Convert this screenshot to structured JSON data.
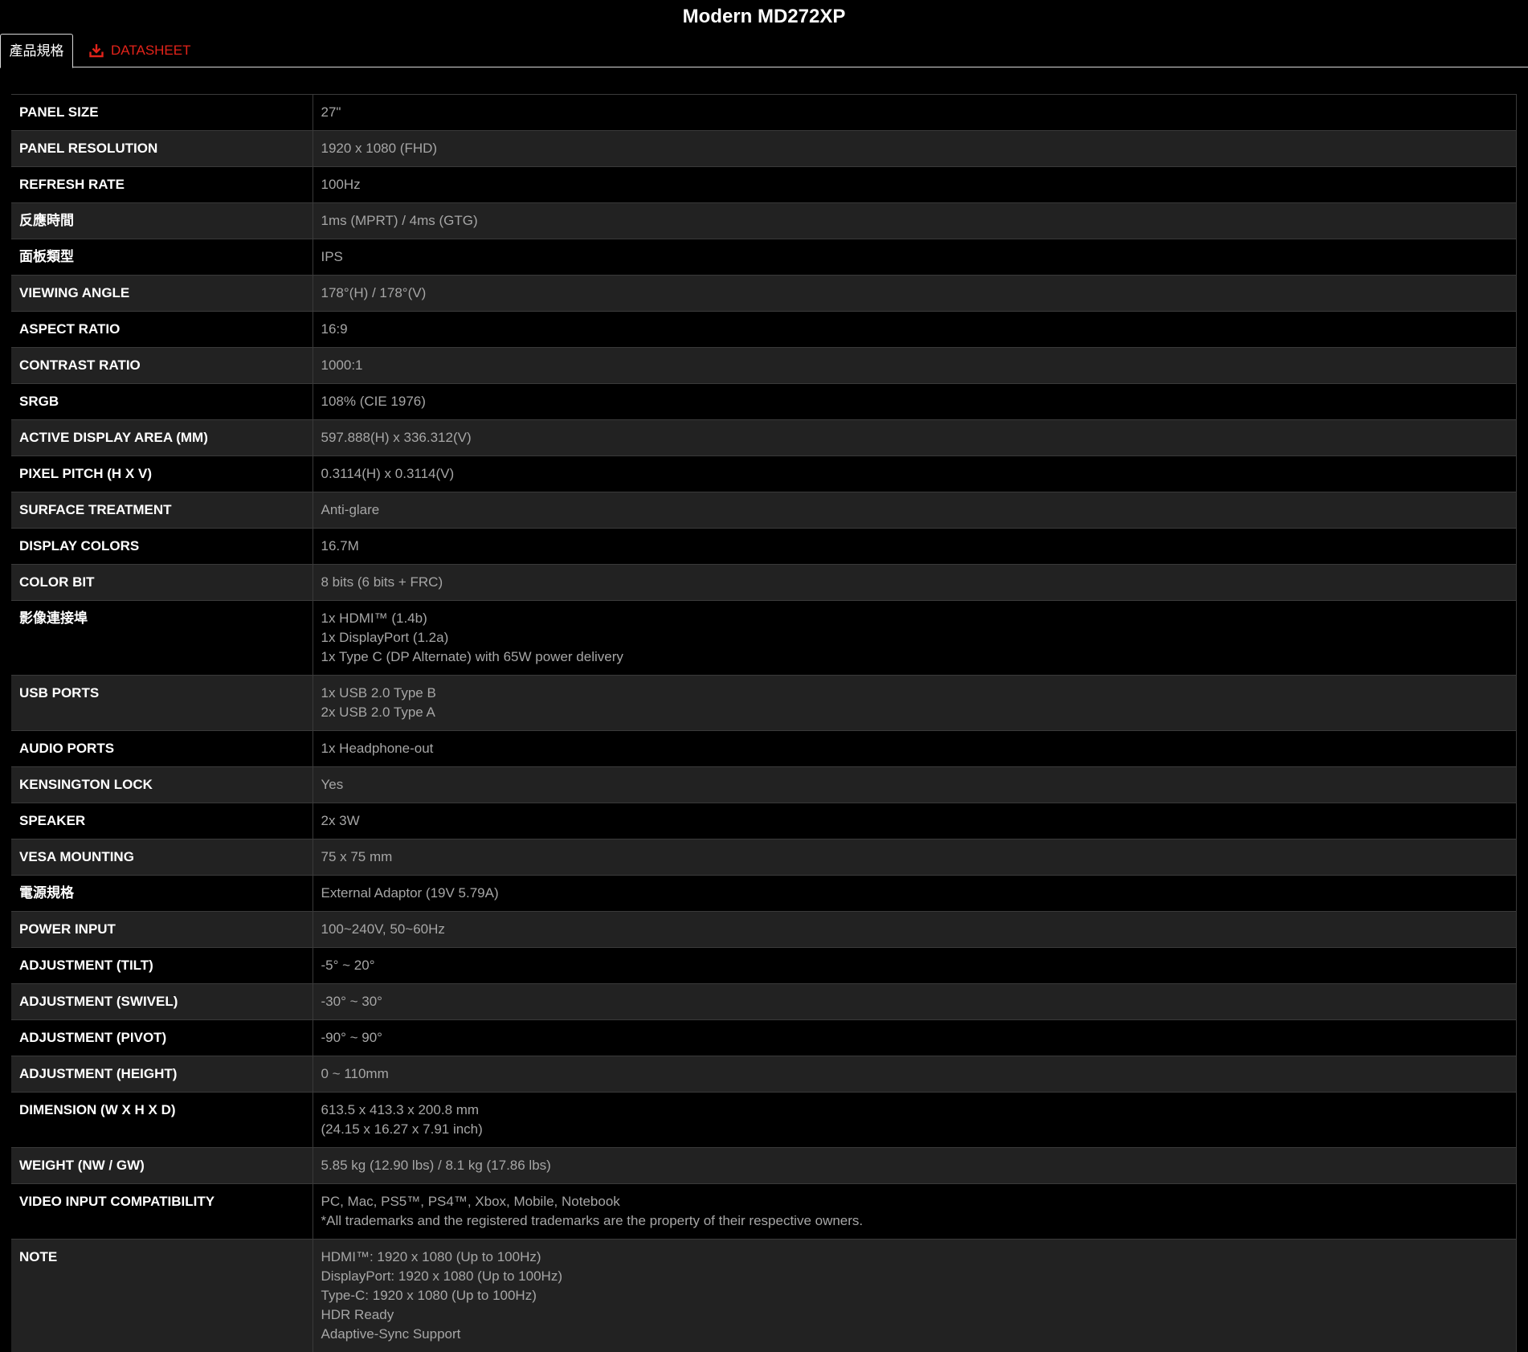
{
  "page": {
    "title": "Modern MD272XP"
  },
  "tabs": [
    {
      "label": "產品規格",
      "active": true
    },
    {
      "label": "DATASHEET",
      "active": false,
      "icon": "download-icon",
      "color": "#e2231a"
    }
  ],
  "specs": [
    {
      "label": "PANEL SIZE",
      "value": [
        "27\""
      ]
    },
    {
      "label": "PANEL RESOLUTION",
      "value": [
        "1920 x 1080 (FHD)"
      ]
    },
    {
      "label": "REFRESH RATE",
      "value": [
        "100Hz"
      ]
    },
    {
      "label": "反應時間",
      "value": [
        "1ms (MPRT) / 4ms (GTG)"
      ]
    },
    {
      "label": "面板類型",
      "value": [
        "IPS"
      ]
    },
    {
      "label": "VIEWING ANGLE",
      "value": [
        "178°(H) / 178°(V)"
      ]
    },
    {
      "label": "ASPECT RATIO",
      "value": [
        "16:9"
      ]
    },
    {
      "label": "CONTRAST RATIO",
      "value": [
        "1000:1"
      ]
    },
    {
      "label": "SRGB",
      "value": [
        "108% (CIE 1976)"
      ]
    },
    {
      "label": "ACTIVE DISPLAY AREA (MM)",
      "value": [
        "597.888(H) x 336.312(V)"
      ]
    },
    {
      "label": "PIXEL PITCH (H X V)",
      "value": [
        "0.3114(H) x 0.3114(V)"
      ]
    },
    {
      "label": "SURFACE TREATMENT",
      "value": [
        "Anti-glare"
      ]
    },
    {
      "label": "DISPLAY COLORS",
      "value": [
        "16.7M"
      ]
    },
    {
      "label": "COLOR BIT",
      "value": [
        "8 bits (6 bits + FRC)"
      ]
    },
    {
      "label": "影像連接埠",
      "value": [
        "1x HDMI™ (1.4b)",
        "1x DisplayPort (1.2a)",
        "1x Type C (DP Alternate) with 65W power delivery"
      ]
    },
    {
      "label": "USB PORTS",
      "value": [
        "1x USB 2.0 Type B",
        "2x USB 2.0 Type A"
      ]
    },
    {
      "label": "AUDIO PORTS",
      "value": [
        "1x Headphone-out"
      ]
    },
    {
      "label": "KENSINGTON LOCK",
      "value": [
        "Yes"
      ]
    },
    {
      "label": "SPEAKER",
      "value": [
        "2x 3W"
      ]
    },
    {
      "label": "VESA MOUNTING",
      "value": [
        "75 x 75 mm"
      ]
    },
    {
      "label": "電源規格",
      "value": [
        "External Adaptor (19V 5.79A)"
      ]
    },
    {
      "label": "POWER INPUT",
      "value": [
        "100~240V, 50~60Hz"
      ]
    },
    {
      "label": "ADJUSTMENT (TILT)",
      "value": [
        "-5° ~ 20°"
      ]
    },
    {
      "label": "ADJUSTMENT (SWIVEL)",
      "value": [
        "-30° ~ 30°"
      ]
    },
    {
      "label": "ADJUSTMENT (PIVOT)",
      "value": [
        "-90° ~ 90°"
      ]
    },
    {
      "label": "ADJUSTMENT (HEIGHT)",
      "value": [
        "0 ~ 110mm"
      ]
    },
    {
      "label": "DIMENSION (W X H X D)",
      "value": [
        "613.5 x 413.3 x 200.8 mm",
        "(24.15 x 16.27 x 7.91 inch)"
      ]
    },
    {
      "label": "WEIGHT (NW / GW)",
      "value": [
        "5.85 kg (12.90 lbs) / 8.1 kg (17.86 lbs)"
      ]
    },
    {
      "label": "VIDEO INPUT COMPATIBILITY",
      "value": [
        "PC, Mac, PS5™, PS4™, Xbox, Mobile, Notebook",
        "*All trademarks and the registered trademarks are the property of their respective owners."
      ]
    },
    {
      "label": "NOTE",
      "value": [
        "HDMI™: 1920 x 1080 (Up to 100Hz)",
        "DisplayPort: 1920 x 1080 (Up to 100Hz)",
        "Type-C: 1920 x 1080 (Up to 100Hz)",
        "HDR Ready",
        "Adaptive-Sync Support"
      ]
    }
  ]
}
